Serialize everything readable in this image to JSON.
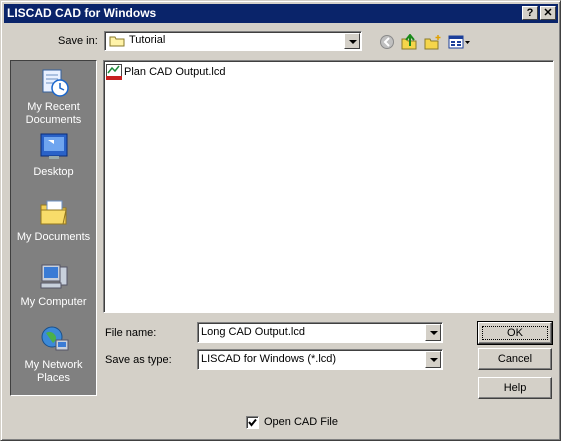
{
  "window": {
    "title": "LISCAD CAD for Windows",
    "help_btn": "?",
    "close_btn": "✕"
  },
  "save_in": {
    "label": "Save in:",
    "value": "Tutorial"
  },
  "toolbar": {
    "icons": [
      "back-icon",
      "up-folder-icon",
      "new-folder-icon",
      "view-menu-icon"
    ]
  },
  "places": [
    {
      "label": "My Recent Documents",
      "icon": "recent-documents-icon"
    },
    {
      "label": "Desktop",
      "icon": "desktop-icon"
    },
    {
      "label": "My Documents",
      "icon": "my-documents-icon"
    },
    {
      "label": "My Computer",
      "icon": "my-computer-icon"
    },
    {
      "label": "My Network Places",
      "icon": "network-places-icon"
    }
  ],
  "files": [
    {
      "name": "Plan CAD Output.lcd",
      "icon": "lcd-file-icon"
    }
  ],
  "filename": {
    "label": "File name:",
    "value": "Long CAD Output.lcd"
  },
  "filetype": {
    "label": "Save as type:",
    "value": "LISCAD for Windows (*.lcd)"
  },
  "buttons": {
    "ok": "OK",
    "cancel": "Cancel",
    "help": "Help"
  },
  "open_cad": {
    "label": "Open CAD File",
    "checked": true
  }
}
